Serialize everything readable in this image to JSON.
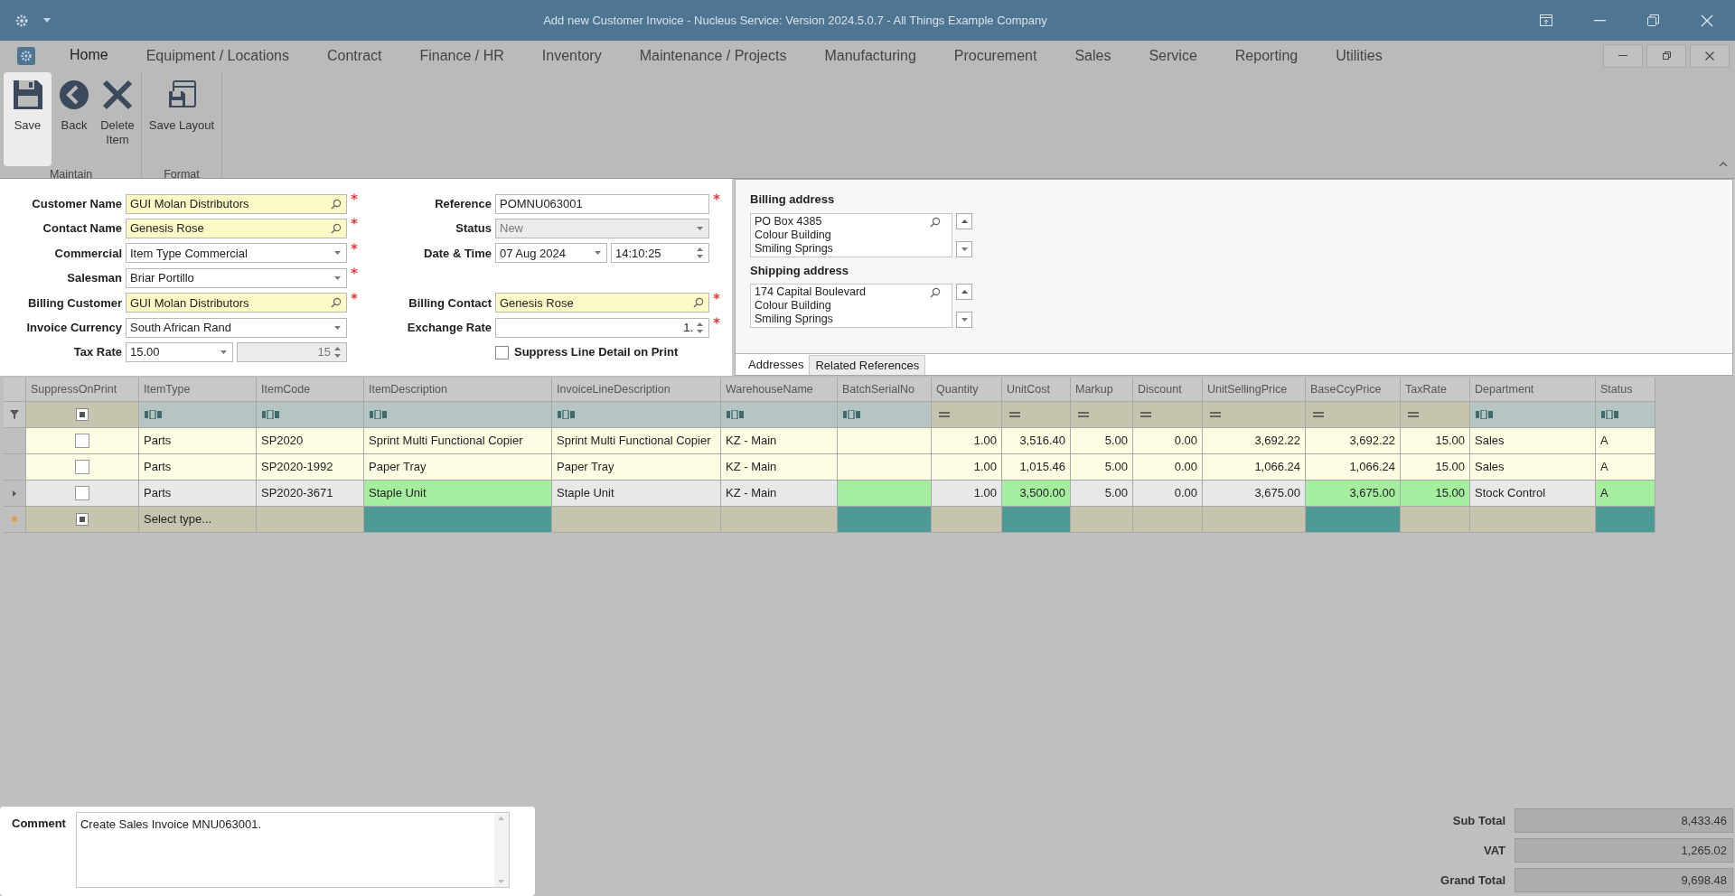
{
  "window": {
    "title": "Add new Customer Invoice - Nucleus Service: Version 2024.5.0.7 - All Things Example Company"
  },
  "menu": {
    "tabs": [
      {
        "label": "Home",
        "selected": true
      },
      {
        "label": "Equipment / Locations",
        "selected": false
      },
      {
        "label": "Contract",
        "selected": false
      },
      {
        "label": "Finance / HR",
        "selected": false
      },
      {
        "label": "Inventory",
        "selected": false
      },
      {
        "label": "Maintenance / Projects",
        "selected": false
      },
      {
        "label": "Manufacturing",
        "selected": false
      },
      {
        "label": "Procurement",
        "selected": false
      },
      {
        "label": "Sales",
        "selected": false
      },
      {
        "label": "Service",
        "selected": false
      },
      {
        "label": "Reporting",
        "selected": false
      },
      {
        "label": "Utilities",
        "selected": false
      }
    ]
  },
  "ribbon": {
    "groups": [
      {
        "label": "Maintain",
        "buttons": [
          {
            "label": "Save",
            "kind": "save",
            "selected": true
          },
          {
            "label": "Back",
            "kind": "back",
            "selected": false
          },
          {
            "label": "Delete Item",
            "kind": "delete",
            "selected": false
          }
        ]
      },
      {
        "label": "Format",
        "buttons": [
          {
            "label": "Save Layout",
            "kind": "layout",
            "selected": false
          }
        ]
      }
    ]
  },
  "form": {
    "left": [
      {
        "label": "Customer Name",
        "kind": "lookup",
        "value": "GUI Molan Distributors",
        "required": true,
        "disabled": false
      },
      {
        "label": "Contact Name",
        "kind": "lookup",
        "value": "Genesis Rose",
        "required": true,
        "disabled": false
      },
      {
        "label": "Commercial",
        "kind": "combo",
        "value": "Item Type Commercial",
        "required": true,
        "disabled": false
      },
      {
        "label": "Salesman",
        "kind": "combo",
        "value": "Briar Portillo",
        "required": true,
        "disabled": false
      },
      {
        "label": "Billing Customer",
        "kind": "lookup",
        "value": "GUI Molan Distributors",
        "required": true,
        "disabled": false
      },
      {
        "label": "Invoice Currency",
        "kind": "combo",
        "value": "South African Rand",
        "required": false,
        "disabled": false
      },
      {
        "label": "Tax Rate",
        "kind": "combo-spin",
        "value": "15.00",
        "value2": "15",
        "required": false,
        "disabled": false
      }
    ],
    "middle": [
      {
        "label": "Reference",
        "kind": "text",
        "value": "POMNU063001",
        "required": true,
        "disabled": false
      },
      {
        "label": "Status",
        "kind": "combo",
        "value": "New",
        "required": false,
        "disabled": true
      },
      {
        "label": "Date & Time",
        "kind": "date-time",
        "value": "07 Aug 2024",
        "value2": "14:10:25",
        "required": false,
        "disabled": false
      },
      {
        "label": "Billing Contact",
        "kind": "lookup",
        "value": "Genesis Rose",
        "required": true,
        "disabled": false
      },
      {
        "label": "Exchange Rate",
        "kind": "spin",
        "value": "1.",
        "required": true,
        "disabled": false
      },
      {
        "label": "Suppress Line Detail on Print",
        "kind": "checkbox",
        "checked": false,
        "required": false,
        "disabled": false
      }
    ],
    "addresses": [
      {
        "label": "Billing address",
        "lines": [
          "PO Box 4385",
          "Colour Building",
          "Smiling Springs"
        ]
      },
      {
        "label": "Shipping address",
        "lines": [
          "174 Capital Boulevard",
          "Colour Building",
          "Smiling Springs"
        ]
      }
    ],
    "tabs": [
      {
        "label": "Addresses",
        "selected": true
      },
      {
        "label": "Related References",
        "selected": false
      }
    ]
  },
  "grid": {
    "columns": [
      {
        "label": "SuppressOnPrint",
        "kind": "check"
      },
      {
        "label": "ItemType",
        "kind": "text"
      },
      {
        "label": "ItemCode",
        "kind": "text"
      },
      {
        "label": "ItemDescription",
        "kind": "text"
      },
      {
        "label": "InvoiceLineDescription",
        "kind": "text"
      },
      {
        "label": "WarehouseName",
        "kind": "text"
      },
      {
        "label": "BatchSerialNo",
        "kind": "text"
      },
      {
        "label": "Quantity",
        "kind": "number"
      },
      {
        "label": "UnitCost",
        "kind": "number"
      },
      {
        "label": "Markup",
        "kind": "number"
      },
      {
        "label": "Discount",
        "kind": "number"
      },
      {
        "label": "UnitSellingPrice",
        "kind": "number"
      },
      {
        "label": "BaseCcyPrice",
        "kind": "number"
      },
      {
        "label": "TaxRate",
        "kind": "number"
      },
      {
        "label": "Department",
        "kind": "text"
      },
      {
        "label": "Status",
        "kind": "text"
      }
    ],
    "rows": [
      {
        "kind": "data",
        "selected": false,
        "cells": [
          {
            "checked": false,
            "flagged": false
          },
          {
            "text": "Parts",
            "flagged": false
          },
          {
            "text": "SP2020",
            "flagged": false
          },
          {
            "text": "Sprint Multi Functional Copier",
            "flagged": false
          },
          {
            "text": "Sprint Multi Functional Copier",
            "flagged": false
          },
          {
            "text": "KZ - Main",
            "flagged": false
          },
          {
            "flagged": false
          },
          {
            "text": "1.00",
            "flagged": false
          },
          {
            "text": "3,516.40",
            "flagged": false
          },
          {
            "text": "5.00",
            "flagged": false
          },
          {
            "text": "0.00",
            "flagged": false
          },
          {
            "text": "3,692.22",
            "flagged": false
          },
          {
            "text": "3,692.22",
            "flagged": false
          },
          {
            "text": "15.00",
            "flagged": false
          },
          {
            "text": "Sales",
            "flagged": false
          },
          {
            "text": "A",
            "flagged": false
          }
        ]
      },
      {
        "kind": "data",
        "selected": false,
        "cells": [
          {
            "checked": false,
            "flagged": false
          },
          {
            "text": "Parts",
            "flagged": false
          },
          {
            "text": "SP2020-1992",
            "flagged": false
          },
          {
            "text": "Paper Tray",
            "flagged": false
          },
          {
            "text": "Paper Tray",
            "flagged": false
          },
          {
            "text": "KZ - Main",
            "flagged": false
          },
          {
            "flagged": false
          },
          {
            "text": "1.00",
            "flagged": false
          },
          {
            "text": "1,015.46",
            "flagged": false
          },
          {
            "text": "5.00",
            "flagged": false
          },
          {
            "text": "0.00",
            "flagged": false
          },
          {
            "text": "1,066.24",
            "flagged": false
          },
          {
            "text": "1,066.24",
            "flagged": false
          },
          {
            "text": "15.00",
            "flagged": false
          },
          {
            "text": "Sales",
            "flagged": false
          },
          {
            "text": "A",
            "flagged": false
          }
        ]
      },
      {
        "kind": "data",
        "selected": true,
        "cells": [
          {
            "checked": false,
            "flagged": false
          },
          {
            "text": "Parts",
            "flagged": false
          },
          {
            "text": "SP2020-3671",
            "flagged": false
          },
          {
            "text": "Staple Unit",
            "flagged": true
          },
          {
            "text": "Staple Unit",
            "flagged": false
          },
          {
            "text": "KZ - Main",
            "flagged": false
          },
          {
            "flagged": true
          },
          {
            "text": "1.00",
            "flagged": false
          },
          {
            "text": "3,500.00",
            "flagged": true
          },
          {
            "text": "5.00",
            "flagged": false
          },
          {
            "text": "0.00",
            "flagged": false
          },
          {
            "text": "3,675.00",
            "flagged": false
          },
          {
            "text": "3,675.00",
            "flagged": true
          },
          {
            "text": "15.00",
            "flagged": true
          },
          {
            "text": "Stock Control",
            "flagged": false
          },
          {
            "text": "A",
            "flagged": true
          }
        ]
      },
      {
        "kind": "new",
        "selected": false,
        "cells": [
          {
            "flagged": false
          },
          {
            "text": "Select type...",
            "flagged": false
          },
          {
            "flagged": false
          },
          {
            "flagged": true
          },
          {
            "flagged": false
          },
          {
            "flagged": false
          },
          {
            "flagged": true
          },
          {
            "flagged": false
          },
          {
            "flagged": true
          },
          {
            "flagged": false
          },
          {
            "flagged": false
          },
          {
            "flagged": false
          },
          {
            "flagged": true
          },
          {
            "flagged": false
          },
          {
            "flagged": false
          },
          {
            "flagged": true
          }
        ]
      }
    ]
  },
  "comment": {
    "label": "Comment",
    "value": "Create Sales Invoice MNU063001."
  },
  "totals": [
    {
      "label": "Sub Total",
      "value": "8,433.46"
    },
    {
      "label": "VAT",
      "value": "1,265.02"
    },
    {
      "label": "Grand Total",
      "value": "9,698.48"
    }
  ]
}
